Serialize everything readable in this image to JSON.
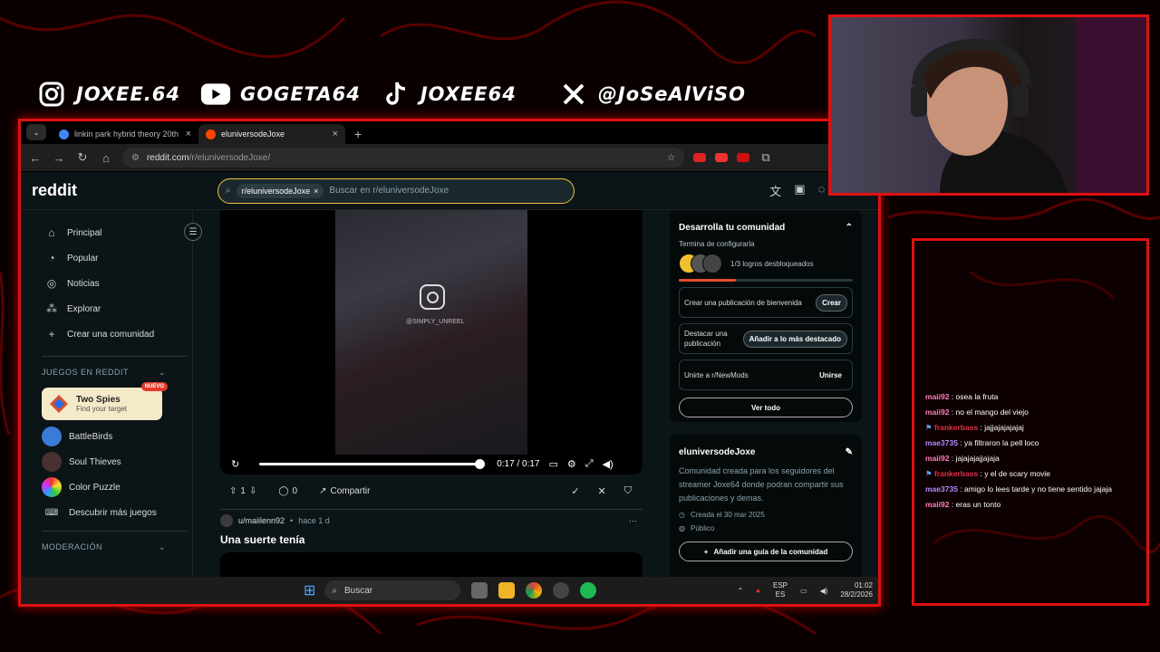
{
  "socials": [
    {
      "icon": "instagram-icon",
      "handle": "JOXEE.64"
    },
    {
      "icon": "youtube-icon",
      "handle": "GOGETA64"
    },
    {
      "icon": "tiktok-icon",
      "handle": "JOXEE64"
    },
    {
      "icon": "x-icon",
      "handle": "@JoSeAlViSO"
    }
  ],
  "browser": {
    "tabs": [
      {
        "title": "linkin park hybrid theory 20th a",
        "active": false
      },
      {
        "title": "eluniversodeJoxe",
        "active": true
      }
    ],
    "new_tab": "+",
    "url_host": "reddit.com",
    "url_path": "/r/eluniversodeJoxe/"
  },
  "reddit": {
    "logo": "reddit",
    "search_chip": "r/eluniversodeJoxe",
    "search_placeholder": "Buscar en r/eluniversodeJoxe",
    "nav": [
      {
        "icon": "home-icon",
        "label": "Principal"
      },
      {
        "icon": "popular-icon",
        "label": "Popular"
      },
      {
        "icon": "news-icon",
        "label": "Noticias"
      },
      {
        "icon": "explore-icon",
        "label": "Explorar"
      },
      {
        "icon": "plus-icon",
        "label": "Crear una comunidad"
      }
    ],
    "games_section": "JUEGOS EN REDDIT",
    "featured_game": {
      "name": "Two Spies",
      "subtitle": "Find your target",
      "badge": "NUEVO"
    },
    "games": [
      "BattleBirds",
      "Soul Thieves",
      "Color Puzzle",
      "Descubrir más juegos"
    ],
    "moderation_section": "MODERACIÓN",
    "video": {
      "watermark": "@SIMPLY_UNREEL",
      "time": "0:17 / 0:17",
      "progress_fraction": 1.0
    },
    "post_actions": {
      "votes": "1",
      "comments": "0",
      "share": "Compartir"
    },
    "post2": {
      "user": "u/maiilenn92",
      "time": "hace 1 d",
      "title": "Una suerte tenía"
    },
    "community_card": {
      "title": "Desarrolla tu comunidad",
      "subtitle": "Termina de configurarla",
      "achievements": "1/3 logros desbloqueados",
      "progress_fraction": 0.33,
      "tasks": [
        {
          "label": "Crear una publicación de bienvenida",
          "button": "Crear"
        },
        {
          "label": "Destacar una publicación",
          "button": "Añadir a lo más destacado"
        },
        {
          "label": "Unirte a r/NewMods",
          "button": "Unirse"
        }
      ],
      "view_all": "Ver todo"
    },
    "about": {
      "name": "eluniversodeJoxe",
      "description": "Comunidad creada para los seguidores del streamer Joxe64 donde podran compartir sus publicaciones y demas.",
      "created": "Creada el 30 mar 2025",
      "visibility": "Público",
      "guide_button": "Añadir una guía de la comunidad"
    }
  },
  "taskbar": {
    "search": "Buscar",
    "lang_top": "ESP",
    "lang_bottom": "ES",
    "time": "01:02",
    "date": "28/2/2026"
  },
  "chat": [
    {
      "user": "maii92",
      "text": ": osea la fruta",
      "color": "#ff7fbf",
      "badge": false
    },
    {
      "user": "maii92",
      "text": ": no el mango del viejo",
      "color": "#ff7fbf",
      "badge": false
    },
    {
      "user": "frankerbass",
      "text": ": jajjajajajajaj",
      "color": "#e0304a",
      "badge": true
    },
    {
      "user": "mae3735",
      "text": ": ya filtraron la pell loco",
      "color": "#b48cff",
      "badge": false
    },
    {
      "user": "maii92",
      "text": ": jajajajajjajaja",
      "color": "#ff7fbf",
      "badge": false
    },
    {
      "user": "frankerbass",
      "text": ": y el de scary movie",
      "color": "#e0304a",
      "badge": true
    },
    {
      "user": "mae3735",
      "text": ": amigo lo lees tarde y no tiene sentido jajaja",
      "color": "#b48cff",
      "badge": false
    },
    {
      "user": "maii92",
      "text": ": eras un tonto",
      "color": "#ff7fbf",
      "badge": false
    }
  ]
}
